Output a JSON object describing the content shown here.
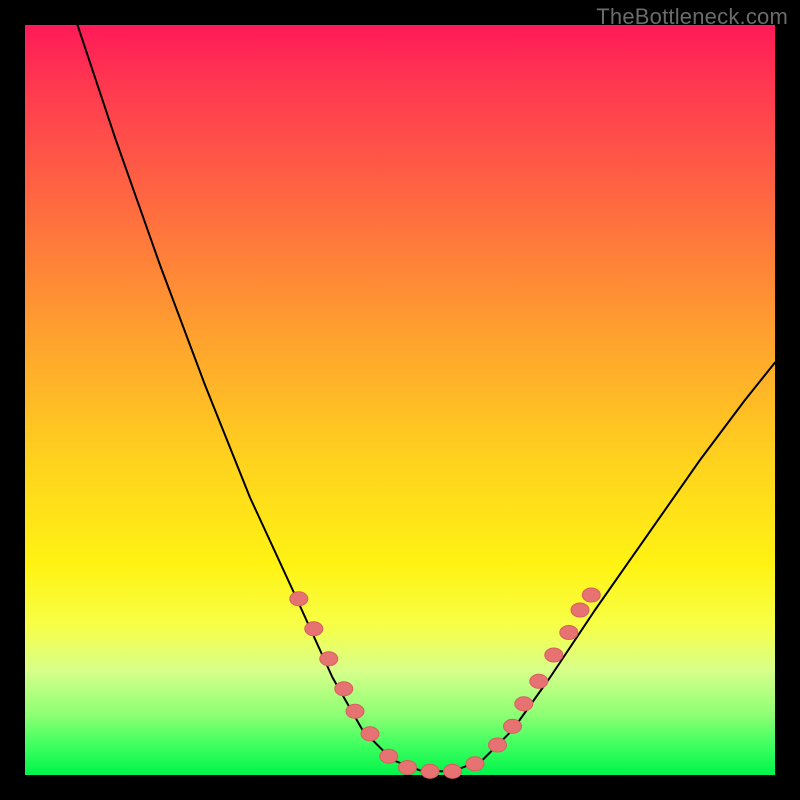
{
  "watermark": "TheBottleneck.com",
  "chart_data": {
    "type": "line",
    "title": "",
    "subtitle": "",
    "xlabel": "",
    "ylabel": "",
    "x_range": [
      0,
      100
    ],
    "y_range": [
      0,
      100
    ],
    "grid": false,
    "legend": false,
    "background_gradient": {
      "top": "#ff1a58",
      "mid": "#fff313",
      "bottom": "#00f54a"
    },
    "curve_points": [
      {
        "x": 7,
        "y": 100
      },
      {
        "x": 12,
        "y": 85
      },
      {
        "x": 18,
        "y": 68
      },
      {
        "x": 24,
        "y": 52
      },
      {
        "x": 30,
        "y": 37
      },
      {
        "x": 36,
        "y": 24
      },
      {
        "x": 41,
        "y": 13
      },
      {
        "x": 45,
        "y": 6
      },
      {
        "x": 49,
        "y": 2
      },
      {
        "x": 53,
        "y": 0.5
      },
      {
        "x": 57,
        "y": 0.5
      },
      {
        "x": 61,
        "y": 2
      },
      {
        "x": 65,
        "y": 6
      },
      {
        "x": 70,
        "y": 13
      },
      {
        "x": 76,
        "y": 22
      },
      {
        "x": 83,
        "y": 32
      },
      {
        "x": 90,
        "y": 42
      },
      {
        "x": 96,
        "y": 50
      },
      {
        "x": 100,
        "y": 55
      }
    ],
    "markers_left": [
      {
        "x": 36.5,
        "y": 23.5
      },
      {
        "x": 38.5,
        "y": 19.5
      },
      {
        "x": 40.5,
        "y": 15.5
      },
      {
        "x": 42.5,
        "y": 11.5
      },
      {
        "x": 44.0,
        "y": 8.5
      },
      {
        "x": 46.0,
        "y": 5.5
      },
      {
        "x": 48.5,
        "y": 2.5
      },
      {
        "x": 51.0,
        "y": 1.0
      },
      {
        "x": 54.0,
        "y": 0.5
      },
      {
        "x": 57.0,
        "y": 0.5
      },
      {
        "x": 60.0,
        "y": 1.5
      }
    ],
    "markers_right": [
      {
        "x": 63.0,
        "y": 4.0
      },
      {
        "x": 65.0,
        "y": 6.5
      },
      {
        "x": 66.5,
        "y": 9.5
      },
      {
        "x": 68.5,
        "y": 12.5
      },
      {
        "x": 70.5,
        "y": 16.0
      },
      {
        "x": 72.5,
        "y": 19.0
      },
      {
        "x": 74.0,
        "y": 22.0
      },
      {
        "x": 75.5,
        "y": 24.0
      }
    ],
    "marker_radius": 9,
    "marker_color": "#e77272"
  }
}
